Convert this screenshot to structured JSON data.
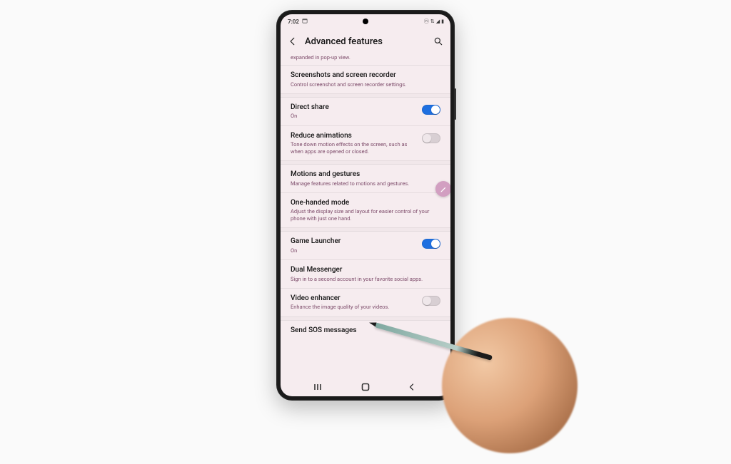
{
  "statusbar": {
    "time": "7:02",
    "icons": {
      "nfc": "⟋",
      "wifi": "▸",
      "signal": "◢",
      "battery": "▮"
    }
  },
  "header": {
    "title": "Advanced features"
  },
  "clip": "expanded in pop-up view.",
  "rows": {
    "screenshots": {
      "title": "Screenshots and screen recorder",
      "sub": "Control screenshot and screen recorder settings."
    },
    "direct_share": {
      "title": "Direct share",
      "sub": "On",
      "on": true
    },
    "reduce_anim": {
      "title": "Reduce animations",
      "sub": "Tone down motion effects on the screen, such as when apps are opened or closed.",
      "on": false
    },
    "motions": {
      "title": "Motions and gestures",
      "sub": "Manage features related to motions and gestures."
    },
    "one_handed": {
      "title": "One-handed mode",
      "sub": "Adjust the display size and layout for easier control of your phone with just one hand."
    },
    "game_launcher": {
      "title": "Game Launcher",
      "sub": "On",
      "on": true
    },
    "dual_msg": {
      "title": "Dual Messenger",
      "sub": "Sign in to a second account in your favorite social apps."
    },
    "video_enh": {
      "title": "Video enhancer",
      "sub": "Enhance the image quality of your videos.",
      "on": false
    },
    "sos": {
      "title": "Send SOS messages"
    }
  },
  "fab_icon": "pencil-icon",
  "colors": {
    "accent": "#1e6fe0",
    "subtext": "#7d4b6a",
    "bg": "#f6ecef"
  }
}
